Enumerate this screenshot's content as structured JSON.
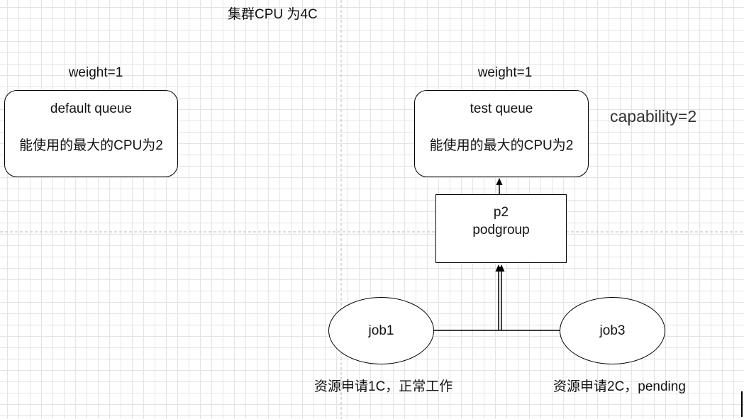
{
  "cluster_title": "集群CPU 为4C",
  "default_queue": {
    "weight": "weight=1",
    "name": "default queue",
    "limit": "能使用的最大的CPU为2"
  },
  "test_queue": {
    "weight": "weight=1",
    "name": "test queue",
    "limit": "能使用的最大的CPU为2",
    "capability": "capability=2"
  },
  "podgroup": {
    "name": "p2",
    "type": "podgroup"
  },
  "job1": {
    "name": "job1",
    "note": "资源申请1C，正常工作"
  },
  "job3": {
    "name": "job3",
    "note": "资源申请2C，pending"
  }
}
